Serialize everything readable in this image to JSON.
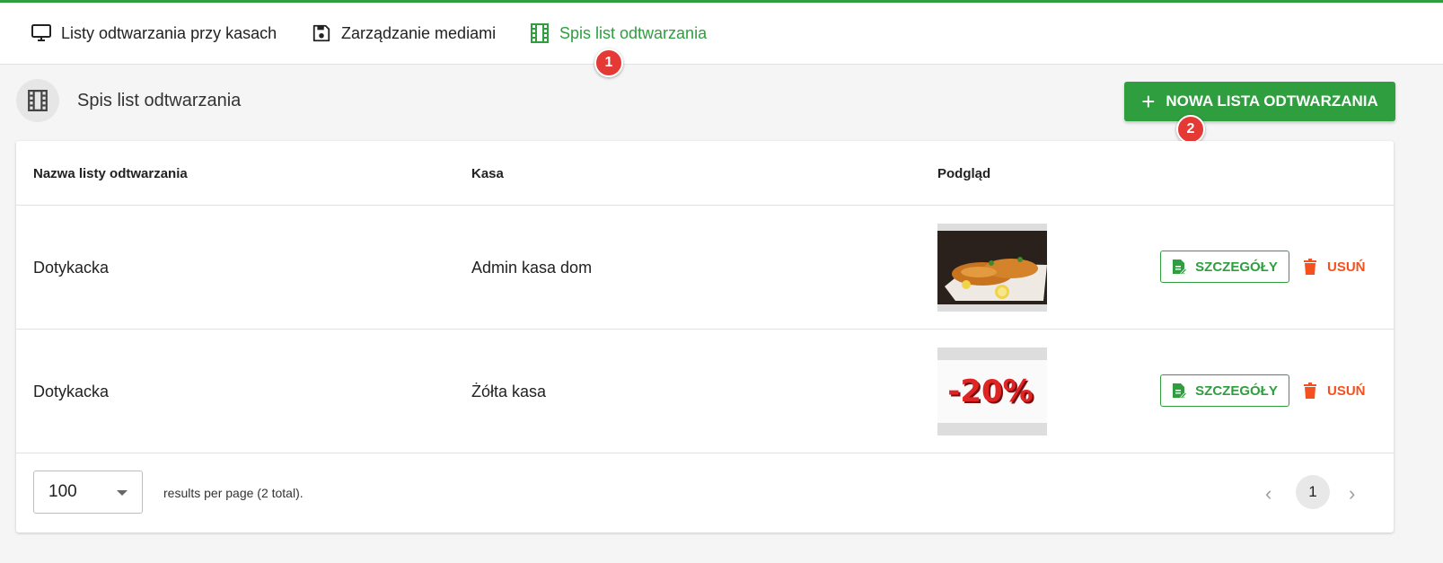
{
  "tabs": [
    {
      "label": "Listy odtwarzania przy kasach",
      "icon": "monitor-icon"
    },
    {
      "label": "Zarządzanie mediami",
      "icon": "floppy-disk-icon"
    },
    {
      "label": "Spis list odtwarzania",
      "icon": "film-icon",
      "active": true
    }
  ],
  "badges": [
    "1",
    "2"
  ],
  "section": {
    "title": "Spis list odtwarzania",
    "icon": "film-icon"
  },
  "new_button": {
    "label": "NOWA LISTA ODTWARZANIA",
    "icon": "plus-icon"
  },
  "table": {
    "headers": [
      "Nazwa listy odtwarzania",
      "Kasa",
      "Podgląd"
    ],
    "rows": [
      {
        "name": "Dotykacka",
        "kasa": "Admin kasa dom",
        "preview": "fried-fish-photo",
        "details": "SZCZEGÓŁY",
        "delete": "USUŃ"
      },
      {
        "name": "Dotykacka",
        "kasa": "Żółta kasa",
        "preview": "discount-20-percent-graphic",
        "preview_text": "-20%",
        "details": "SZCZEGÓŁY",
        "delete": "USUŃ"
      }
    ]
  },
  "pagination": {
    "per_page": "100",
    "summary": "results per page (2 total).",
    "current_page": "1"
  },
  "colors": {
    "accent": "#2e9e3e",
    "danger": "#f4511e",
    "badge": "#e53935"
  }
}
